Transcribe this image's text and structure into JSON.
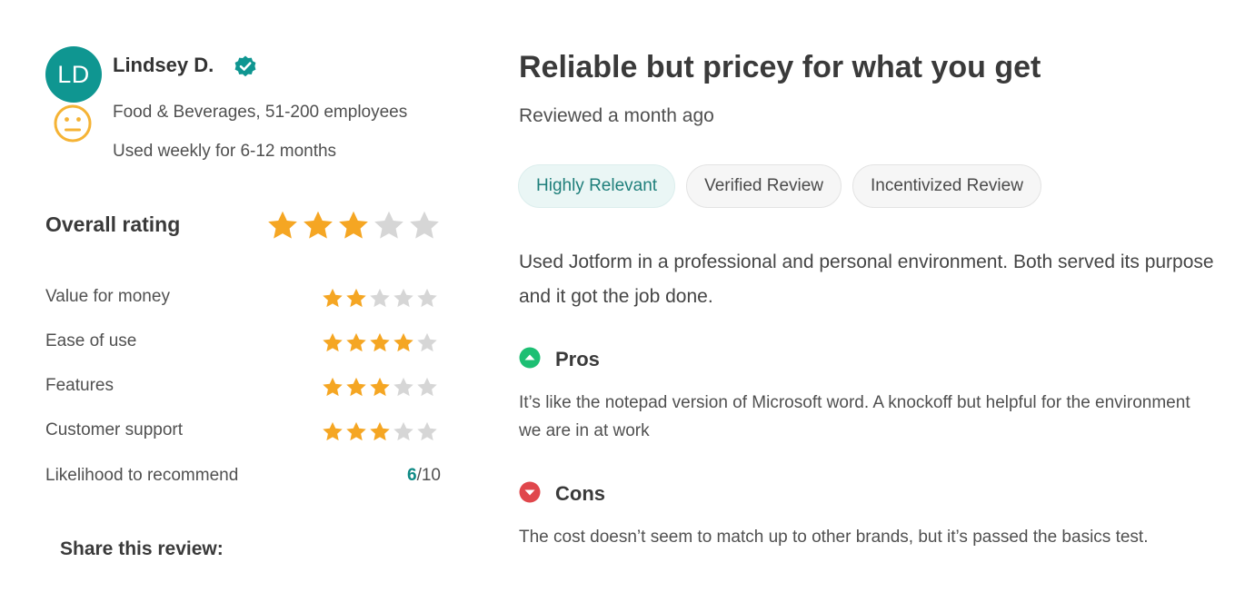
{
  "reviewer": {
    "initials": "LD",
    "name": "Lindsey D.",
    "industry": "Food & Beverages, 51-200 employees",
    "usage": "Used weekly for 6-12 months",
    "avatar_color": "#0f9691",
    "sentiment_icon": "neutral-face-icon",
    "verified_icon": "verified-badge-icon"
  },
  "ratings": {
    "overall_label": "Overall rating",
    "overall_value": 3,
    "max": 5,
    "star_color": "#f5a623",
    "empty_star_color": "#d6d6d6",
    "categories": [
      {
        "label": "Value for money",
        "value": 2
      },
      {
        "label": "Ease of use",
        "value": 4
      },
      {
        "label": "Features",
        "value": 3
      },
      {
        "label": "Customer support",
        "value": 3
      }
    ],
    "recommend_label": "Likelihood to recommend",
    "recommend_score": "6",
    "recommend_max": "/10"
  },
  "share": {
    "label": "Share this review:"
  },
  "review": {
    "title": "Reliable but pricey for what you get",
    "reviewed": "Reviewed a month ago",
    "tags": [
      "Highly Relevant",
      "Verified Review",
      "Incentivized Review"
    ],
    "summary": "Used Jotform in a professional and personal environment. Both served its purpose and it got the job done.",
    "pros_label": "Pros",
    "pros_text": "It’s like the notepad version of Microsoft word. A knockoff but helpful for the environment we are in at work",
    "cons_label": "Cons",
    "cons_text": "The cost doesn’t seem to match up to other brands, but it’s passed the basics test.",
    "pros_color": "#1dbf73",
    "cons_color": "#e0474c"
  }
}
